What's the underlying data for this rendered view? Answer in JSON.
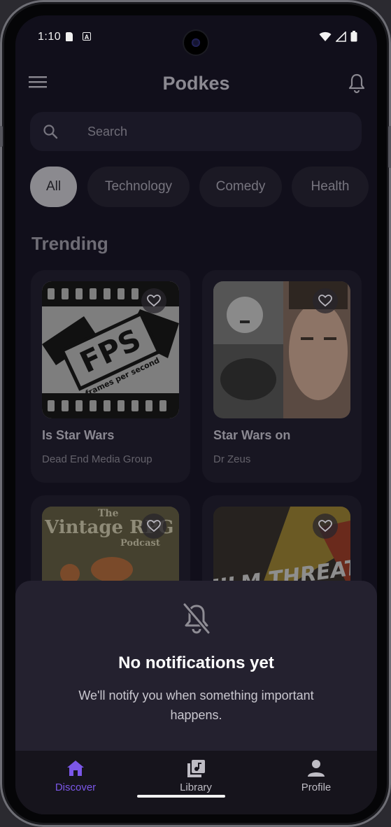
{
  "status_bar": {
    "time": "1:10"
  },
  "app": {
    "title": "Podkes"
  },
  "search": {
    "placeholder": "Search"
  },
  "categories": [
    {
      "label": "All",
      "selected": true
    },
    {
      "label": "Technology",
      "selected": false
    },
    {
      "label": "Comedy",
      "selected": false
    },
    {
      "label": "Health",
      "selected": false
    }
  ],
  "trending": {
    "title": "Trending",
    "items": [
      {
        "title": "Is Star Wars",
        "author": "Dead End Media Group",
        "art_text": "FPS",
        "art_subtext": "frames per second"
      },
      {
        "title": "Star Wars on",
        "author": "Dr Zeus"
      },
      {
        "title": "",
        "author": "",
        "art_text": "Vintage RPG",
        "art_top": "The",
        "art_bottom": "Podcast"
      },
      {
        "title": "",
        "author": "",
        "art_text": "FILM THREAT"
      }
    ]
  },
  "notifications_sheet": {
    "title": "No notifications yet",
    "message": "We'll notify you when something important happens."
  },
  "bottom_nav": [
    {
      "label": "Discover",
      "icon": "home-icon",
      "active": true
    },
    {
      "label": "Library",
      "icon": "library-music-icon",
      "active": false
    },
    {
      "label": "Profile",
      "icon": "person-icon",
      "active": false
    }
  ],
  "colors": {
    "accent": "#7b57e8",
    "background": "#110f1b",
    "sheet": "#24212f"
  }
}
